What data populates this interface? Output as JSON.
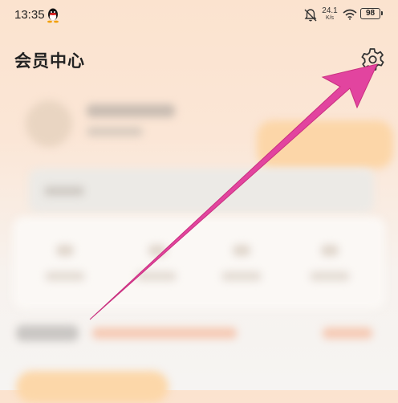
{
  "status_bar": {
    "time": "13:35",
    "net_speed_value": "24.1",
    "net_speed_unit": "K/s",
    "battery": "98",
    "icons": [
      "qq-icon",
      "mute-bell-icon",
      "wifi-icon",
      "battery-icon"
    ]
  },
  "header": {
    "title": "会员中心",
    "settings_icon": "gear-icon"
  },
  "annotation": {
    "type": "arrow",
    "color": "#e2449f",
    "target": "settings-button"
  },
  "colors": {
    "background_top": "#fbe3cf",
    "background_bottom": "#f6f4f2",
    "arrow": "#e2449f"
  }
}
